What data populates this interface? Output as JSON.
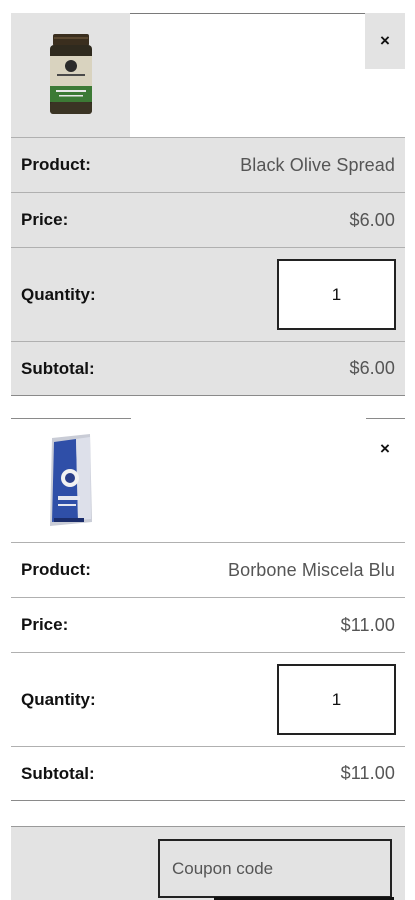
{
  "cart": {
    "remove_label": "×",
    "labels": {
      "product": "Product:",
      "price": "Price:",
      "quantity": "Quantity:",
      "subtotal": "Subtotal:"
    },
    "items": [
      {
        "product": "Black Olive Spread",
        "price": "$6.00",
        "quantity": "1",
        "subtotal": "$6.00",
        "thumbnail": "olive-spread-jar"
      },
      {
        "product": "Borbone Miscela Blu",
        "price": "$11.00",
        "quantity": "1",
        "subtotal": "$11.00",
        "thumbnail": "coffee-bag"
      }
    ]
  },
  "coupon": {
    "placeholder": "Coupon code"
  },
  "colors": {
    "row_background": "#e3e3e3",
    "border": "#222222"
  }
}
